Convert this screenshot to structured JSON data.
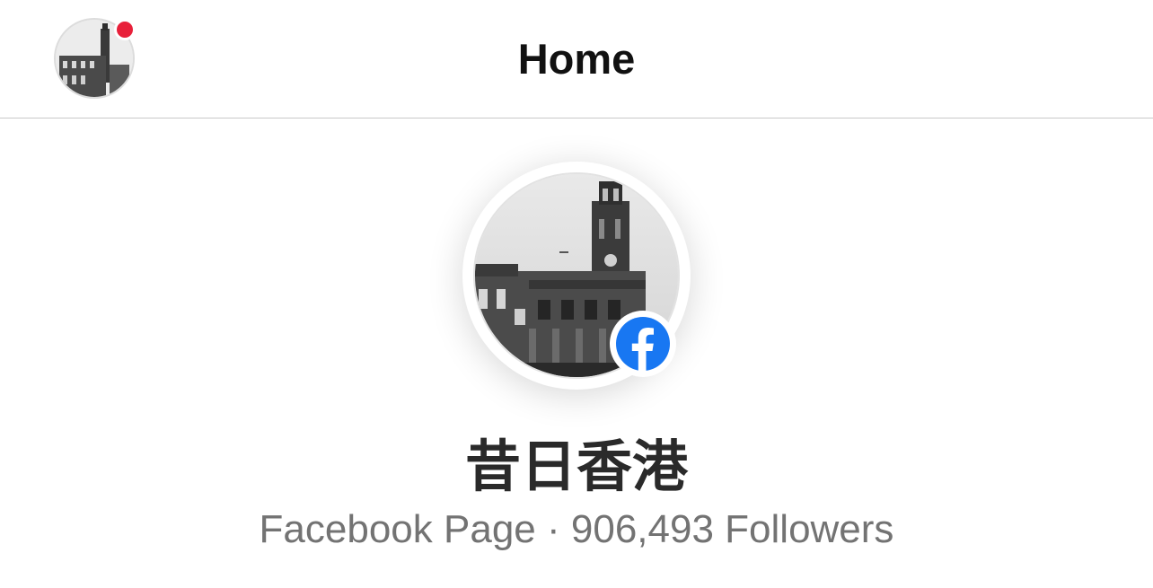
{
  "header": {
    "title": "Home",
    "avatar_icon": "page-avatar-thumbnail",
    "has_notification": true,
    "notification_color": "#e8203a"
  },
  "profile": {
    "name": "昔日香港",
    "type_label": "Facebook Page",
    "separator": "·",
    "followers_text": "906,493 Followers",
    "badge_icon": "facebook-logo-icon",
    "badge_color": "#1877f2"
  }
}
